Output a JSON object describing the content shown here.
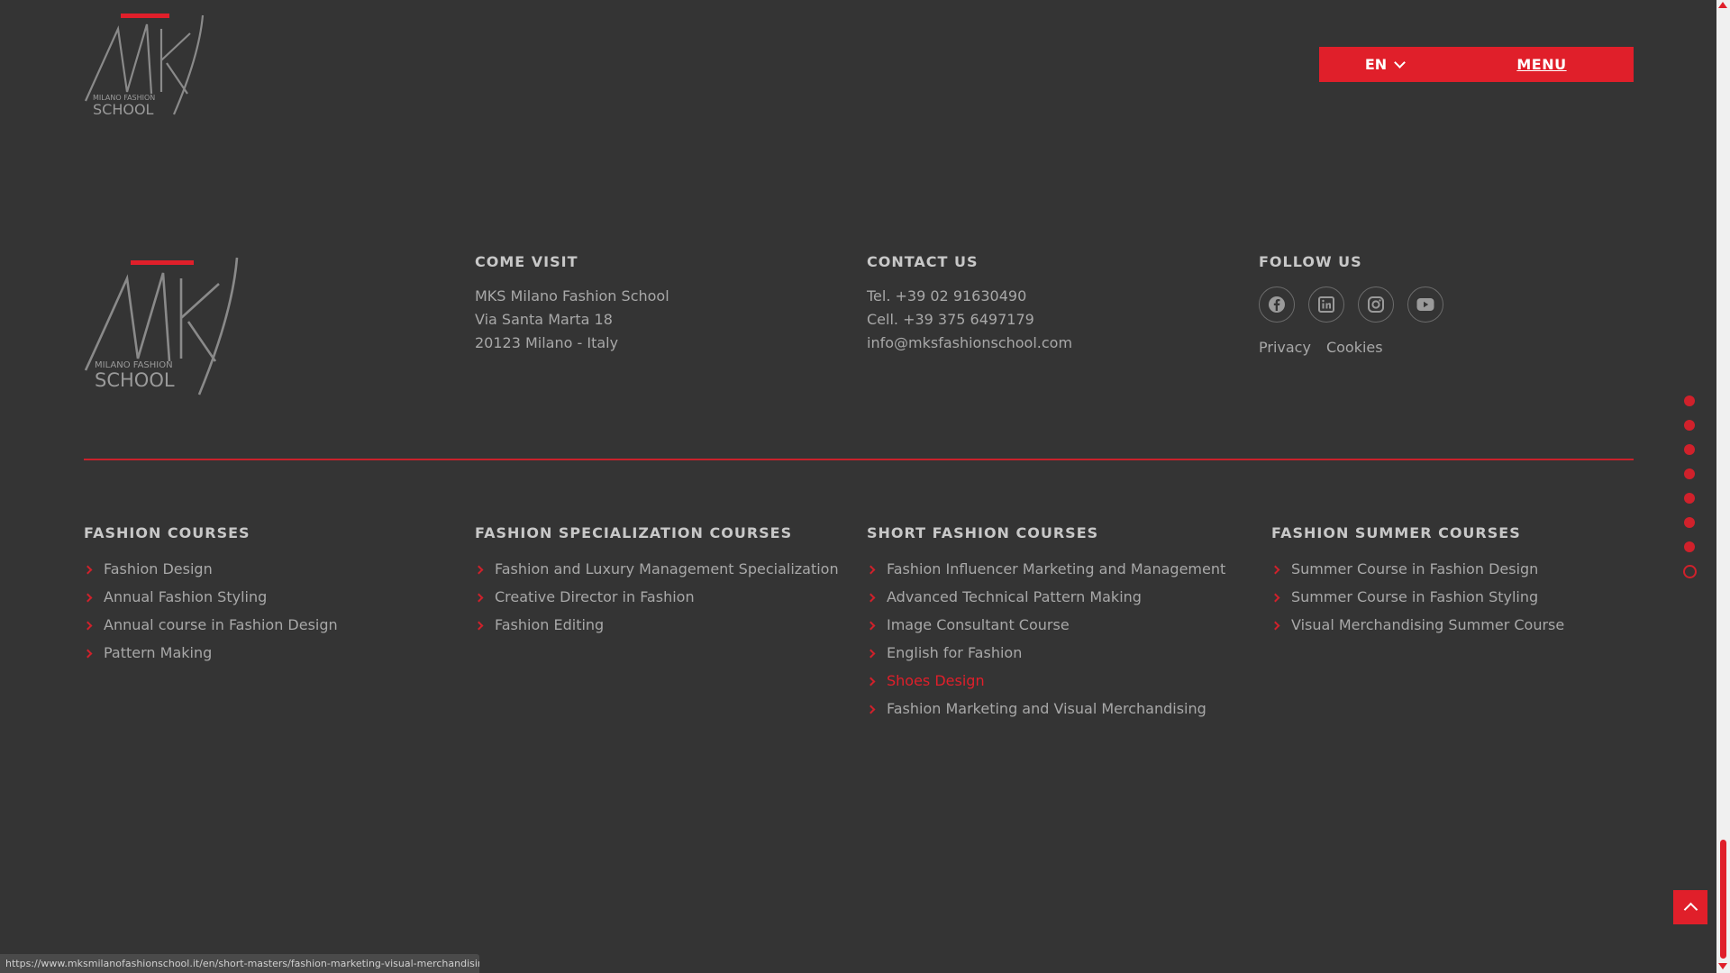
{
  "brand": {
    "logo_monogram": "MKS",
    "logo_line1": "MILANO FASHION",
    "logo_line2": "SCHOOL",
    "accent_color": "#e01f2a",
    "background_color": "#343434"
  },
  "header": {
    "language": "EN",
    "menu_label": "MENU"
  },
  "footer": {
    "visit": {
      "title": "COME VISIT",
      "lines": [
        "MKS Milano Fashion School",
        "Via Santa Marta 18",
        "20123 Milano - Italy"
      ]
    },
    "contact": {
      "title": "CONTACT US",
      "tel": "Tel. +39 02 91630490",
      "cell": "Cell. +39 375 6497179",
      "email": "info@mksfashionschool.com"
    },
    "follow": {
      "title": "FOLLOW US",
      "icons": [
        "facebook-icon",
        "linkedin-icon",
        "instagram-icon",
        "youtube-icon"
      ],
      "privacy": "Privacy",
      "cookies": "Cookies"
    },
    "course_groups": [
      {
        "title": "FASHION COURSES",
        "items": [
          "Fashion Design",
          "Annual Fashion Styling",
          "Annual course in Fashion Design",
          "Pattern Making"
        ]
      },
      {
        "title": "FASHION SPECIALIZATION COURSES",
        "items": [
          "Fashion and Luxury Management Specialization",
          "Creative Director in Fashion",
          "Fashion Editing"
        ]
      },
      {
        "title": "SHORT FASHION COURSES",
        "items": [
          "Fashion Influencer Marketing and Management",
          "Advanced Technical Pattern Making",
          "Image Consultant Course",
          "English for Fashion",
          "Shoes Design",
          "Fashion Marketing and Visual Merchandising"
        ],
        "active_item": "Shoes Design"
      },
      {
        "title": "FASHION SUMMER COURSES",
        "items": [
          "Summer Course in Fashion Design",
          "Summer Course in Fashion Styling",
          "Visual Merchandising Summer Course"
        ]
      }
    ]
  },
  "dot_nav": {
    "count": 8,
    "active_index": 7
  },
  "status_url": "https://www.mksmilanofashionschool.it/en/short-masters/fashion-marketing-visual-merchandising"
}
